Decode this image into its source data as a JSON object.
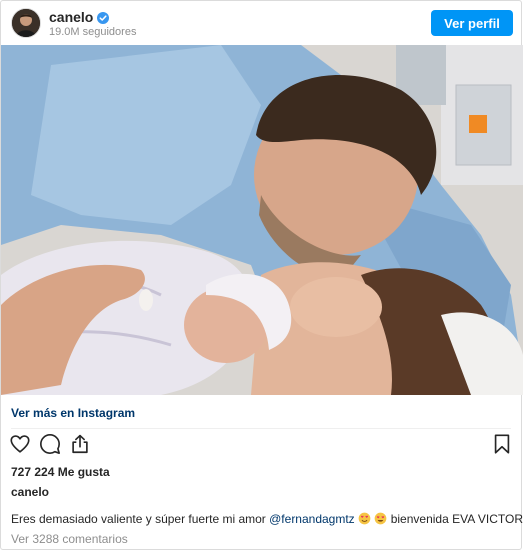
{
  "post": {
    "username": "canelo",
    "followers": "19.0M seguidores",
    "follow_label": "Ver perfil",
    "view_more_label": "Ver más en Instagram",
    "likes": "727 224 Me gusta",
    "caption_user": "canelo",
    "caption_before_mention": "Eres demasiado valiente y súper fuerte mi amor ",
    "mention": "@fernandagmtz",
    "caption_after_emojis": " bienvenida EVA VICTORIA",
    "comments": "Ver 3288 comentarios",
    "colors": {
      "follow_button": "#0095f6",
      "link": "#00376b",
      "muted": "#8e8e8e",
      "verified": "#3897f0",
      "heart_emoji": "#e8305b"
    },
    "icons": [
      "verified-badge-icon",
      "heart-icon",
      "comment-icon",
      "share-icon",
      "bookmark-icon"
    ]
  }
}
